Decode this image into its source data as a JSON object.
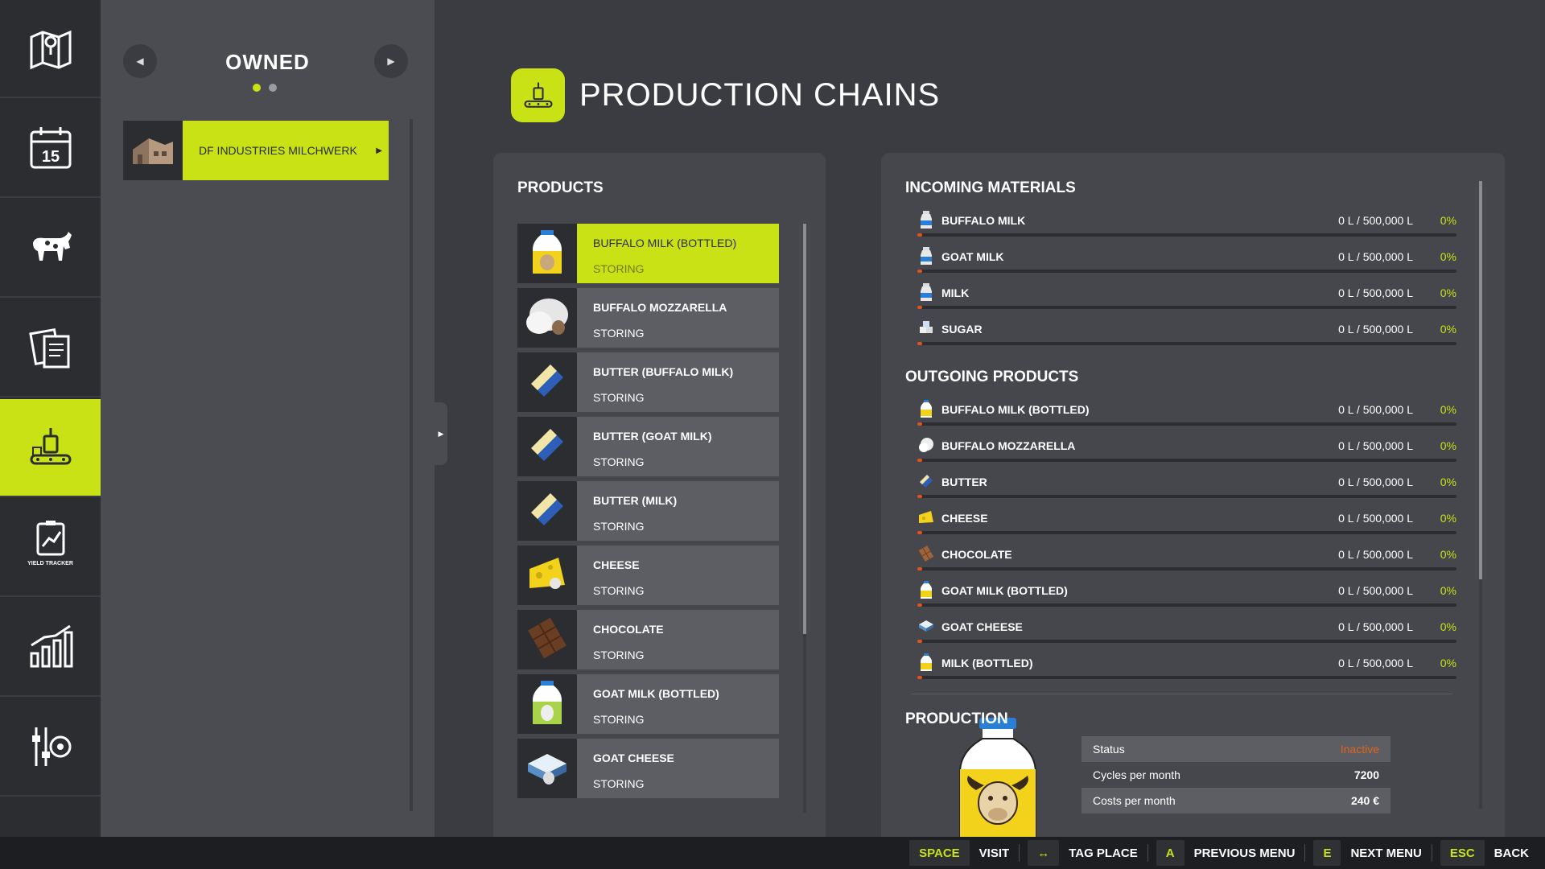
{
  "rail": {
    "items": [
      {
        "icon": "map-icon",
        "label": ""
      },
      {
        "icon": "calendar-icon",
        "label": ""
      },
      {
        "icon": "cow-icon",
        "label": ""
      },
      {
        "icon": "documents-icon",
        "label": ""
      },
      {
        "icon": "production-icon",
        "label": "",
        "active": true
      },
      {
        "icon": "yield-tracker-icon",
        "label": "YIELD TRACKER"
      },
      {
        "icon": "statistics-icon",
        "label": ""
      },
      {
        "icon": "settings-icon",
        "label": ""
      }
    ],
    "calendar_day": "15"
  },
  "owned": {
    "title": "OWNED",
    "page_count": 2,
    "current_page": 1,
    "entry_label": "DF INDUSTRIES MILCHWERK"
  },
  "header": {
    "title": "PRODUCTION CHAINS"
  },
  "products": {
    "title": "PRODUCTS",
    "items": [
      {
        "name": "BUFFALO MILK (BOTTLED)",
        "state": "STORING",
        "icon": "buffalo-milk-bottle-icon",
        "selected": true
      },
      {
        "name": "BUFFALO MOZZARELLA",
        "state": "STORING",
        "icon": "mozzarella-icon"
      },
      {
        "name": "BUTTER (BUFFALO MILK)",
        "state": "STORING",
        "icon": "butter-icon"
      },
      {
        "name": "BUTTER (GOAT MILK)",
        "state": "STORING",
        "icon": "butter-icon"
      },
      {
        "name": "BUTTER (MILK)",
        "state": "STORING",
        "icon": "butter-icon"
      },
      {
        "name": "CHEESE",
        "state": "STORING",
        "icon": "cheese-icon"
      },
      {
        "name": "CHOCOLATE",
        "state": "STORING",
        "icon": "chocolate-icon"
      },
      {
        "name": "GOAT MILK (BOTTLED)",
        "state": "STORING",
        "icon": "goat-milk-bottle-icon"
      },
      {
        "name": "GOAT CHEESE",
        "state": "STORING",
        "icon": "goat-cheese-icon"
      }
    ]
  },
  "incoming": {
    "title": "INCOMING MATERIALS",
    "items": [
      {
        "name": "BUFFALO MILK",
        "amount": "0 L / 500,000 L",
        "pct": "0%",
        "icon": "milk-can-icon"
      },
      {
        "name": "GOAT MILK",
        "amount": "0 L / 500,000 L",
        "pct": "0%",
        "icon": "milk-can-icon"
      },
      {
        "name": "MILK",
        "amount": "0 L / 500,000 L",
        "pct": "0%",
        "icon": "milk-can-icon"
      },
      {
        "name": "SUGAR",
        "amount": "0 L / 500,000 L",
        "pct": "0%",
        "icon": "sugar-icon"
      }
    ]
  },
  "outgoing": {
    "title": "OUTGOING PRODUCTS",
    "items": [
      {
        "name": "BUFFALO MILK (BOTTLED)",
        "amount": "0 L / 500,000 L",
        "pct": "0%",
        "icon": "bottle-icon"
      },
      {
        "name": "BUFFALO MOZZARELLA",
        "amount": "0 L / 500,000 L",
        "pct": "0%",
        "icon": "mozzarella-icon"
      },
      {
        "name": "BUTTER",
        "amount": "0 L / 500,000 L",
        "pct": "0%",
        "icon": "butter-icon"
      },
      {
        "name": "CHEESE",
        "amount": "0 L / 500,000 L",
        "pct": "0%",
        "icon": "cheese-icon"
      },
      {
        "name": "CHOCOLATE",
        "amount": "0 L / 500,000 L",
        "pct": "0%",
        "icon": "chocolate-icon"
      },
      {
        "name": "GOAT MILK (BOTTLED)",
        "amount": "0 L / 500,000 L",
        "pct": "0%",
        "icon": "bottle-icon"
      },
      {
        "name": "GOAT CHEESE",
        "amount": "0 L / 500,000 L",
        "pct": "0%",
        "icon": "goat-cheese-icon"
      },
      {
        "name": "MILK (BOTTLED)",
        "amount": "0 L / 500,000 L",
        "pct": "0%",
        "icon": "bottle-icon"
      }
    ]
  },
  "production": {
    "title": "PRODUCTION",
    "status_label": "Status",
    "status_value": "Inactive",
    "cycles_label": "Cycles per month",
    "cycles_value": "7200",
    "costs_label": "Costs per month",
    "costs_value": "240 €"
  },
  "footer": {
    "keys": [
      {
        "key": "SPACE",
        "label": "VISIT"
      },
      {
        "key": "↔",
        "label": "TAG PLACE"
      },
      {
        "key": "A",
        "label": "PREVIOUS MENU"
      },
      {
        "key": "E",
        "label": "NEXT MENU"
      },
      {
        "key": "ESC",
        "label": "BACK"
      }
    ]
  },
  "colors": {
    "accent": "#c8e216",
    "warning": "#e0641c",
    "bg_dark": "#2b2d31",
    "bg_panel": "#45474c"
  }
}
